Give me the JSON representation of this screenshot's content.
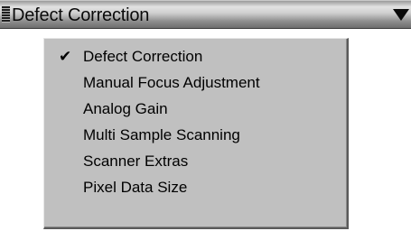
{
  "dropdown": {
    "title": "Defect Correction",
    "grip_icon": "grip-lines-icon",
    "arrow_icon": "triangle-down-icon"
  },
  "menu": {
    "check_glyph": "✔",
    "items": [
      {
        "label": "Defect Correction",
        "checked": true
      },
      {
        "label": "Manual Focus Adjustment",
        "checked": false
      },
      {
        "label": "Analog Gain",
        "checked": false
      },
      {
        "label": "Multi Sample Scanning",
        "checked": false
      },
      {
        "label": "Scanner Extras",
        "checked": false
      },
      {
        "label": "Pixel Data Size",
        "checked": false
      }
    ]
  },
  "colors": {
    "menu_background": "#c0c0c0",
    "text": "#000000"
  }
}
